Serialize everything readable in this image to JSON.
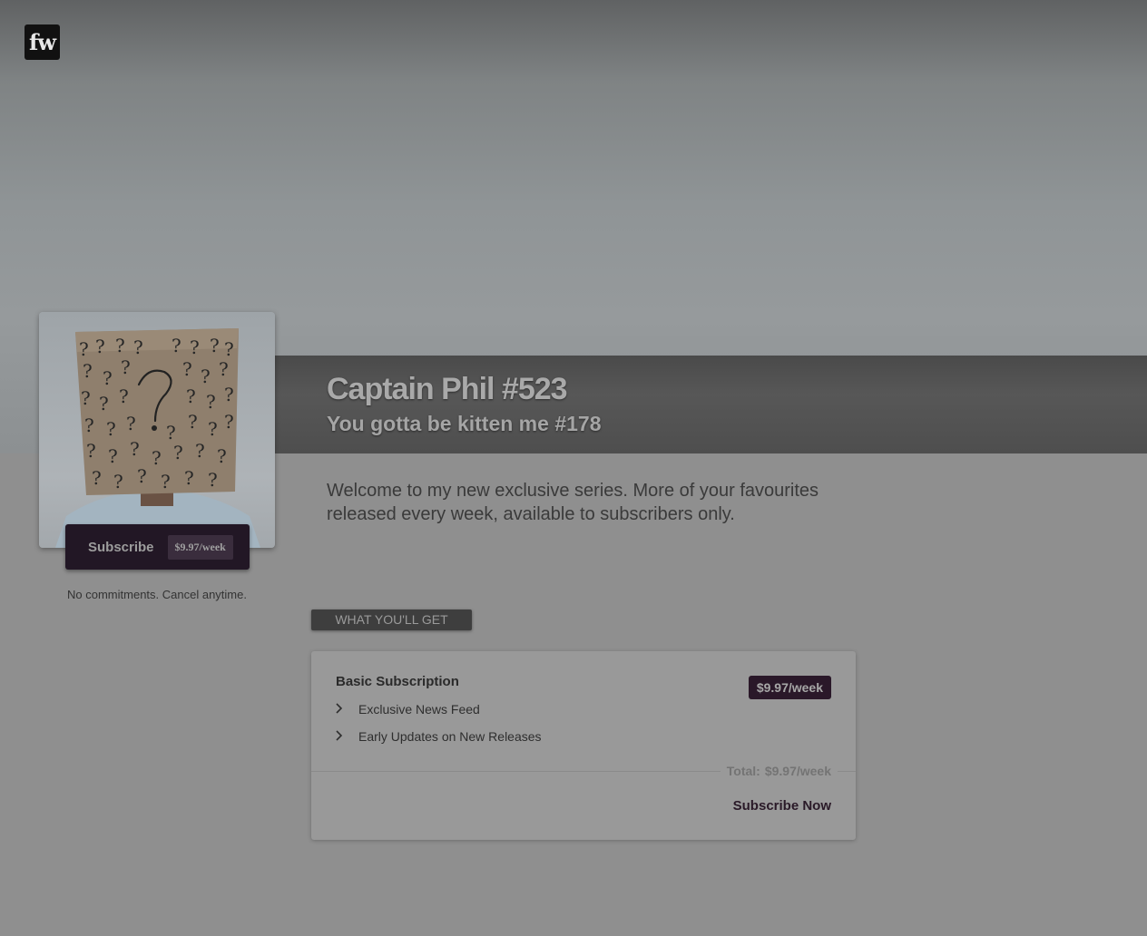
{
  "header": {
    "logo_text": "fw"
  },
  "profile": {
    "title": "Captain Phil #523",
    "subtitle": "You gotta be kitten me #178",
    "welcome": "Welcome to my new exclusive series. More of your favourites released every week, available to subscribers only."
  },
  "sidebar": {
    "subscribe_label": "Subscribe",
    "subscribe_price": "$9.97/week",
    "no_commitments": "No commitments. Cancel anytime."
  },
  "plans": {
    "section_label": "WHAT YOU'LL GET",
    "plan_name": "Basic Subscription",
    "plan_price": "$9.97/week",
    "features": [
      "Exclusive News Feed",
      "Early Updates on New Releases"
    ],
    "total_label": "Total:",
    "total_value": "$9.97/week",
    "subscribe_now_label": "Subscribe Now"
  },
  "colors": {
    "accent": "#2a1829",
    "button": "#221725",
    "title_band": "#4e4e4e"
  }
}
